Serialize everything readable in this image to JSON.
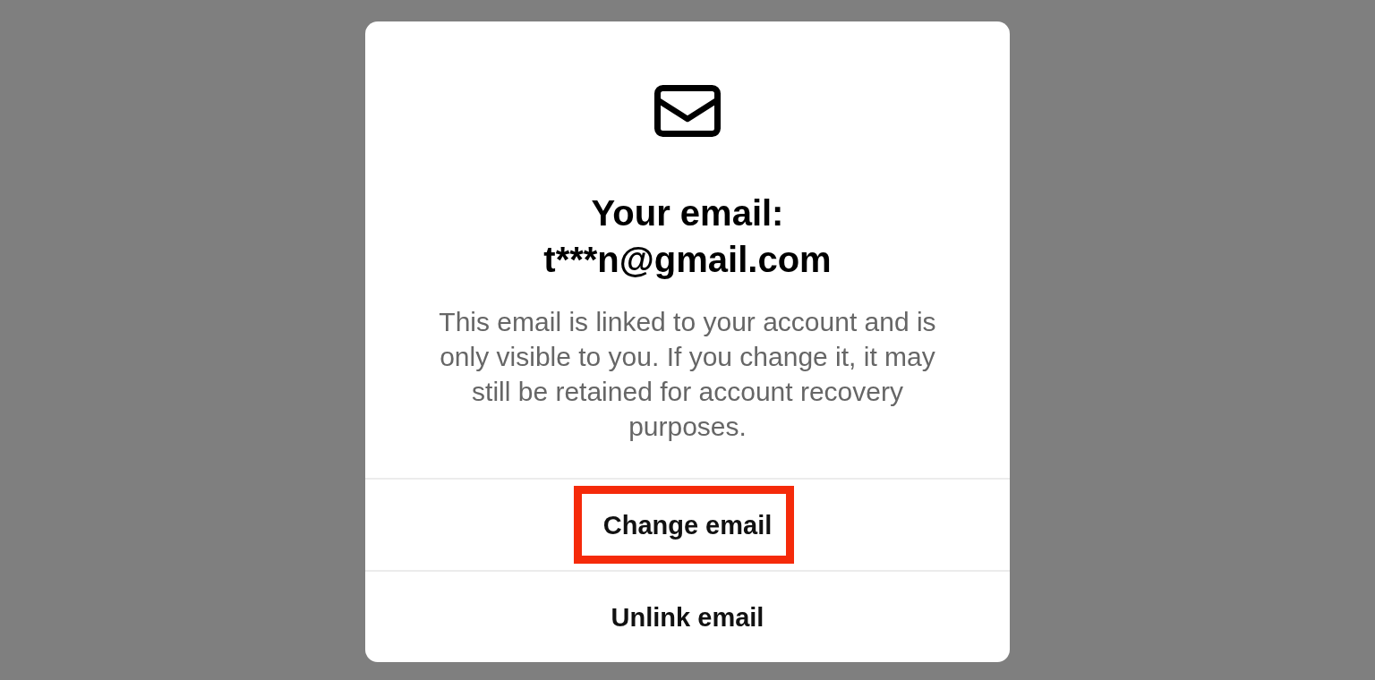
{
  "dialog": {
    "title": "Your email: t***n@gmail.com",
    "message": "This email is linked to your account and is only visible to you. If you change it, it may still be retained for account recovery purposes.",
    "actions": [
      {
        "label": "Change email",
        "highlighted": true
      },
      {
        "label": "Unlink email",
        "highlighted": false
      }
    ]
  }
}
